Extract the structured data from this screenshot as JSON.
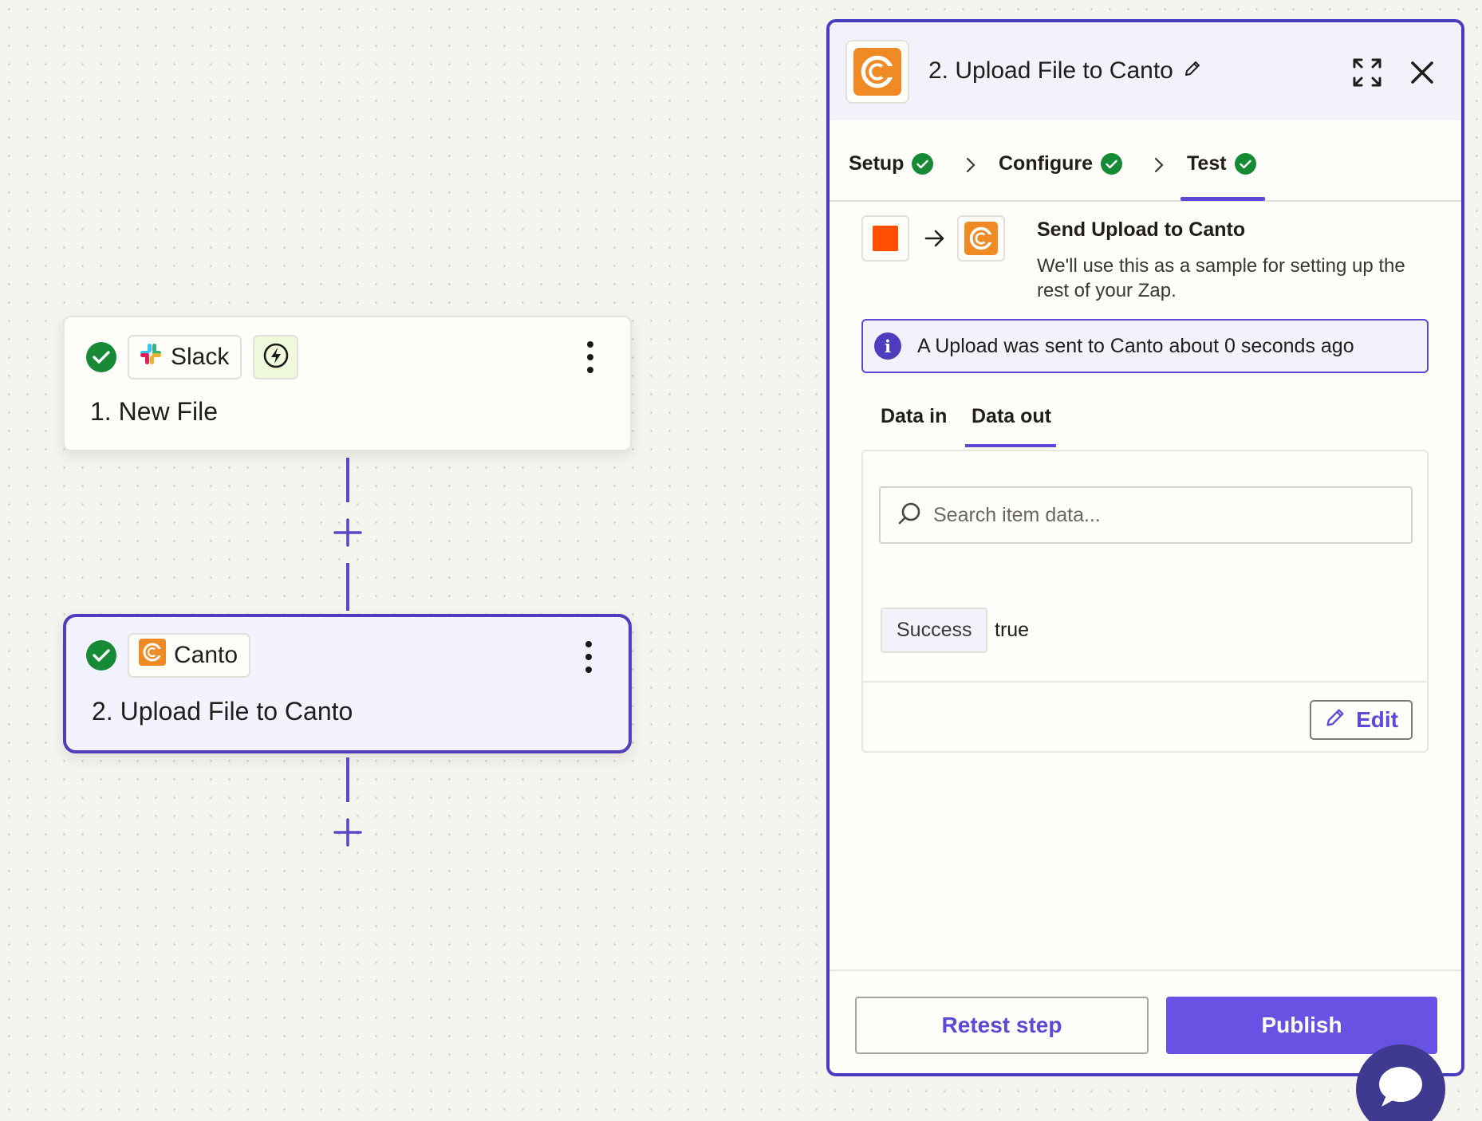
{
  "flow": {
    "step1": {
      "app_name": "Slack",
      "title": "1. New File"
    },
    "step2": {
      "app_name": "Canto",
      "title": "2. Upload File to Canto"
    }
  },
  "panel": {
    "title": "2. Upload File to Canto",
    "stepper": {
      "setup": "Setup",
      "configure": "Configure",
      "test": "Test"
    },
    "sample": {
      "title": "Send Upload to Canto",
      "description": "We'll use this as a sample for setting up the rest of your Zap."
    },
    "alert": "A Upload was sent to Canto about 0 seconds ago",
    "tabs": {
      "data_in": "Data in",
      "data_out": "Data out"
    },
    "search": {
      "placeholder": "Search item data..."
    },
    "result": {
      "key": "Success",
      "value": "true"
    },
    "edit_label": "Edit",
    "retest_label": "Retest step",
    "publish_label": "Publish"
  },
  "colors": {
    "accent": "#5b4ad6",
    "success": "#178a35",
    "canto_orange": "#f08a24",
    "trigger_orange": "#ff4f00"
  },
  "icons": [
    "check-icon",
    "slack-logo-icon",
    "bolt-icon",
    "kebab-icon",
    "plus-icon",
    "canto-logo-icon",
    "pencil-icon",
    "expand-icon",
    "close-icon",
    "chevron-right-icon",
    "arrow-right-icon",
    "info-icon",
    "search-icon",
    "chat-icon"
  ]
}
